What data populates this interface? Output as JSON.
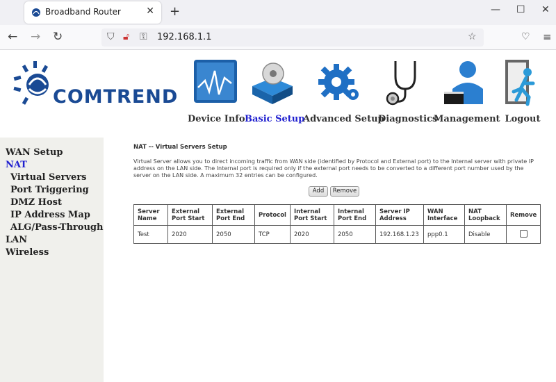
{
  "browser": {
    "tab_title": "Broadband Router",
    "url": "192.168.1.1"
  },
  "header": {
    "brand": "COMTREND",
    "menu": [
      {
        "label": "Device Info",
        "icon": "device-info-chart-icon"
      },
      {
        "label": "Basic Setup",
        "icon": "basic-setup-disc-icon",
        "active": true
      },
      {
        "label": "Advanced Setup",
        "icon": "advanced-setup-gear-icon"
      },
      {
        "label": "Diagnostics",
        "icon": "stethoscope-icon"
      },
      {
        "label": "Management",
        "icon": "management-person-icon"
      },
      {
        "label": "Logout",
        "icon": "logout-exit-icon"
      }
    ]
  },
  "leftnav": {
    "items": [
      {
        "label": "WAN Setup"
      },
      {
        "label": "NAT",
        "active": true
      },
      {
        "label": "Virtual Servers"
      },
      {
        "label": "Port Triggering"
      },
      {
        "label": "DMZ Host"
      },
      {
        "label": "IP Address Map"
      },
      {
        "label": "ALG/Pass-Through"
      },
      {
        "label": "LAN"
      },
      {
        "label": "Wireless"
      }
    ]
  },
  "main": {
    "title": "NAT -- Virtual Servers Setup",
    "description": "Virtual Server allows you to direct incoming traffic from WAN side (identified by Protocol and External port) to the Internal server with private IP address on the LAN side. The Internal port is required only if the external port needs to be converted to a different port number used by the server on the LAN side. A maximum 32 entries can be configured.",
    "add_label": "Add",
    "remove_label": "Remove",
    "table": {
      "headers": [
        "Server Name",
        "External Port Start",
        "External Port End",
        "Protocol",
        "Internal Port Start",
        "Internal Port End",
        "Server IP Address",
        "WAN Interface",
        "NAT Loopback",
        "Remove"
      ],
      "rows": [
        [
          "Test",
          "2020",
          "2050",
          "TCP",
          "2020",
          "2050",
          "192.168.1.23",
          "ppp0.1",
          "Disable"
        ]
      ]
    }
  },
  "colors": {
    "brand_blue": "#1a4a94",
    "active_link": "#1f1fcf",
    "sidebar_bg": "#f0f0ec"
  }
}
